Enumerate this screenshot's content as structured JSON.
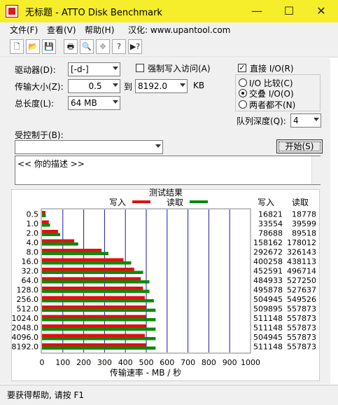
{
  "window": {
    "title": "无标题 - ATTO Disk Benchmark",
    "controls": {
      "minimize": "—",
      "maximize": "☐",
      "close": "✕"
    }
  },
  "menu": {
    "file": "文件(F)",
    "view": "查看(V)",
    "help": "帮助(H)",
    "site": "汉化: www.upantool.com"
  },
  "toolbar": {
    "new": "🗋",
    "open": "📂",
    "save": "💾",
    "print": "🖶",
    "preview": "🔍",
    "move": "✥",
    "help": "?",
    "whatsthis": "▶?"
  },
  "form": {
    "drive_label": "驱动器(D):",
    "drive_value": "[-d-]",
    "force_write_label": "强制写入访问(A)",
    "transfer_label": "传输大小(Z):",
    "transfer_from": "0.5",
    "transfer_to_label": "到",
    "transfer_to": "8192.0",
    "transfer_unit": "KB",
    "total_label": "总长度(L):",
    "total_value": "64 MB",
    "direct_io_label": "直接 I/O(R)",
    "io_compare_label": "I/O 比较(C)",
    "overlapped_io_label": "交叠 I/O(O)",
    "neither_label": "两者都不(N)",
    "queue_label": "队列深度(Q):",
    "queue_value": "4",
    "controlled_by_label": "受控制于(B):",
    "controlled_by_value": "",
    "start_button": "开始(S)",
    "description": "<<  你的描述  >>"
  },
  "results": {
    "title": "测试结果",
    "legend_write": "写入",
    "legend_read": "读取",
    "col_write": "写入",
    "col_read": "读取",
    "rows": [
      {
        "size": "0.5",
        "write": "16821",
        "read": "18778"
      },
      {
        "size": "1.0",
        "write": "33554",
        "read": "39599"
      },
      {
        "size": "2.0",
        "write": "78688",
        "read": "89518"
      },
      {
        "size": "4.0",
        "write": "158162",
        "read": "178012"
      },
      {
        "size": "8.0",
        "write": "292672",
        "read": "326143"
      },
      {
        "size": "16.0",
        "write": "400258",
        "read": "438113"
      },
      {
        "size": "32.0",
        "write": "452591",
        "read": "496714"
      },
      {
        "size": "64.0",
        "write": "484933",
        "read": "527250"
      },
      {
        "size": "128.0",
        "write": "495878",
        "read": "527637"
      },
      {
        "size": "256.0",
        "write": "504945",
        "read": "549526"
      },
      {
        "size": "512.0",
        "write": "509895",
        "read": "557873"
      },
      {
        "size": "1024.0",
        "write": "511148",
        "read": "557873"
      },
      {
        "size": "2048.0",
        "write": "511148",
        "read": "557873"
      },
      {
        "size": "4096.0",
        "write": "504945",
        "read": "557873"
      },
      {
        "size": "8192.0",
        "write": "511148",
        "read": "557873"
      }
    ]
  },
  "chart_data": {
    "type": "bar",
    "orientation": "horizontal",
    "title": "测试结果",
    "xlabel": "传输速率 - MB / 秒",
    "ylabel": "",
    "xlim": [
      0,
      1000
    ],
    "xticks": [
      "0",
      "100",
      "200",
      "300",
      "400",
      "500",
      "600",
      "700",
      "800",
      "900",
      "1000"
    ],
    "categories": [
      "0.5",
      "1.0",
      "2.0",
      "4.0",
      "8.0",
      "16.0",
      "32.0",
      "64.0",
      "128.0",
      "256.0",
      "512.0",
      "1024.0",
      "2048.0",
      "4096.0",
      "8192.0"
    ],
    "series": [
      {
        "name": "写入",
        "color": "#e01010",
        "values": [
          16.4,
          32.8,
          76.8,
          154.5,
          285.8,
          390.9,
          442.0,
          473.6,
          484.3,
          493.1,
          497.9,
          499.2,
          499.2,
          493.1,
          499.2
        ]
      },
      {
        "name": "读取",
        "color": "#0a8a0a",
        "values": [
          18.3,
          38.7,
          87.4,
          173.8,
          318.5,
          427.8,
          485.1,
          514.9,
          515.3,
          536.6,
          544.8,
          544.8,
          544.8,
          544.8,
          544.8
        ]
      }
    ],
    "grid": true,
    "gridline_color": "#1a1aa8"
  },
  "status": {
    "text": "要获得帮助, 请按 F1"
  }
}
